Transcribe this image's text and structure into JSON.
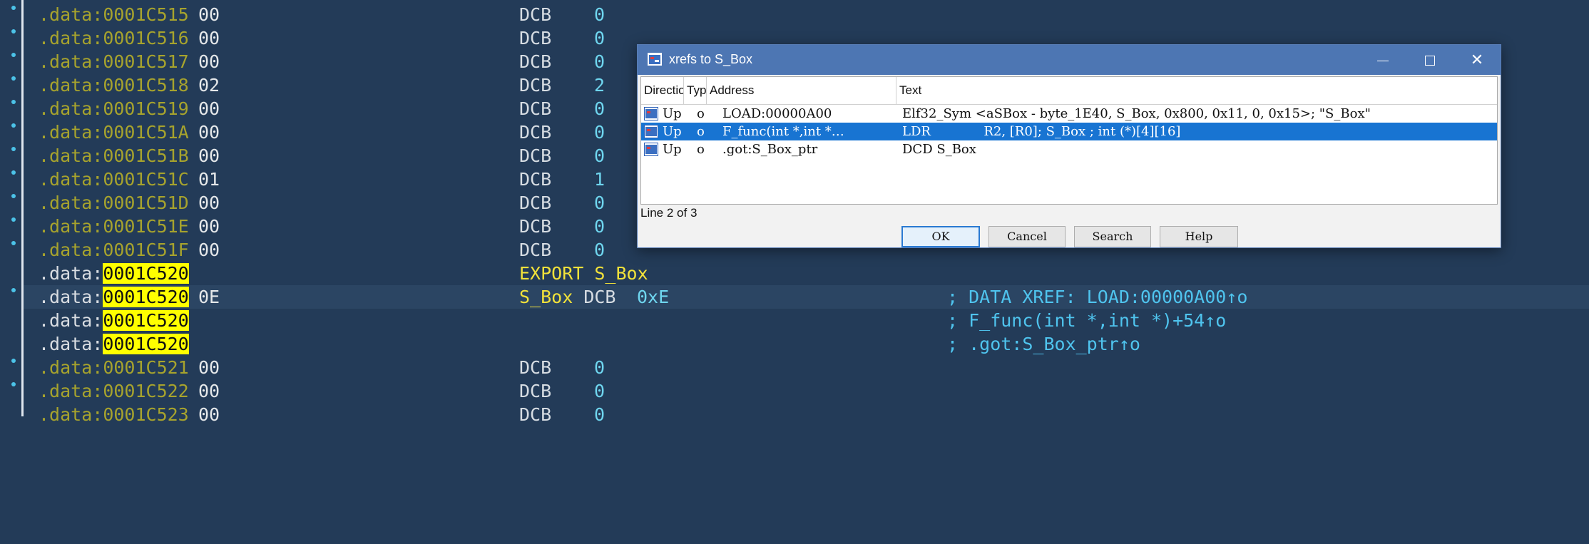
{
  "listing": {
    "rows": [
      {
        "seg": ".data:",
        "off": "0001C515",
        "bytes": "00",
        "mnem": "DCB",
        "oper": "0"
      },
      {
        "seg": ".data:",
        "off": "0001C516",
        "bytes": "00",
        "mnem": "DCB",
        "oper": "0"
      },
      {
        "seg": ".data:",
        "off": "0001C517",
        "bytes": "00",
        "mnem": "DCB",
        "oper": "0"
      },
      {
        "seg": ".data:",
        "off": "0001C518",
        "bytes": "02",
        "mnem": "DCB",
        "oper": "2"
      },
      {
        "seg": ".data:",
        "off": "0001C519",
        "bytes": "00",
        "mnem": "DCB",
        "oper": "0"
      },
      {
        "seg": ".data:",
        "off": "0001C51A",
        "bytes": "00",
        "mnem": "DCB",
        "oper": "0"
      },
      {
        "seg": ".data:",
        "off": "0001C51B",
        "bytes": "00",
        "mnem": "DCB",
        "oper": "0"
      },
      {
        "seg": ".data:",
        "off": "0001C51C",
        "bytes": "01",
        "mnem": "DCB",
        "oper": "1"
      },
      {
        "seg": ".data:",
        "off": "0001C51D",
        "bytes": "00",
        "mnem": "DCB",
        "oper": "0"
      },
      {
        "seg": ".data:",
        "off": "0001C51E",
        "bytes": "00",
        "mnem": "DCB",
        "oper": "0"
      },
      {
        "seg": ".data:",
        "off": "0001C51F",
        "bytes": "00",
        "mnem": "DCB",
        "oper": "0"
      }
    ],
    "export_row": {
      "seg": ".data:",
      "off": "0001C520",
      "text": "EXPORT S_Box"
    },
    "label_row": {
      "seg": ".data:",
      "off": "0001C520",
      "bytes": "0E",
      "label": "S_Box",
      "mnem": "DCB",
      "oper": "0xE",
      "comment": "; DATA XREF: LOAD:00000A00↑o"
    },
    "xref_row1": {
      "seg": ".data:",
      "off": "0001C520",
      "comment": "; F_func(int *,int *)+54↑o"
    },
    "xref_row2": {
      "seg": ".data:",
      "off": "0001C520",
      "comment": "; .got:S_Box_ptr↑o"
    },
    "rows_after": [
      {
        "seg": ".data:",
        "off": "0001C521",
        "bytes": "00",
        "mnem": "DCB",
        "oper": "0"
      },
      {
        "seg": ".data:",
        "off": "0001C522",
        "bytes": "00",
        "mnem": "DCB",
        "oper": "0"
      },
      {
        "seg": ".data:",
        "off": "0001C523",
        "bytes": "00",
        "mnem": "DCB",
        "oper": "0"
      }
    ]
  },
  "dialog": {
    "title": "xrefs to S_Box",
    "columns": [
      "Directio",
      "Typ",
      "Address",
      "Text"
    ],
    "rows": [
      {
        "direction": "Up",
        "type": "o",
        "address": "LOAD:00000A00",
        "text": "Elf32_Sym <aSBox - byte_1E40, S_Box, 0x800, 0x11, 0, 0x15>; \"S_Box\"",
        "selected": false
      },
      {
        "direction": "Up",
        "type": "o",
        "address": "F_func(int *,int *…",
        "text": "LDR             R2, [R0]; S_Box ; int (*)[4][16]",
        "selected": true
      },
      {
        "direction": "Up",
        "type": "o",
        "address": ".got:S_Box_ptr",
        "text": "DCD S_Box",
        "selected": false
      }
    ],
    "status": "Line 2 of 3",
    "buttons": {
      "ok": "OK",
      "cancel": "Cancel",
      "search": "Search",
      "help": "Help"
    }
  },
  "colors": {
    "background": "#233b58",
    "address": "#a7a32d",
    "highlight": "#ffff00",
    "comment": "#4fc4ee",
    "titlebar": "#4d76b3",
    "selection": "#1874d2"
  },
  "icons": [
    "bullet-dot-icon",
    "app-window-icon",
    "minimize-icon",
    "maximize-icon",
    "close-icon",
    "xref-row-icon"
  ]
}
